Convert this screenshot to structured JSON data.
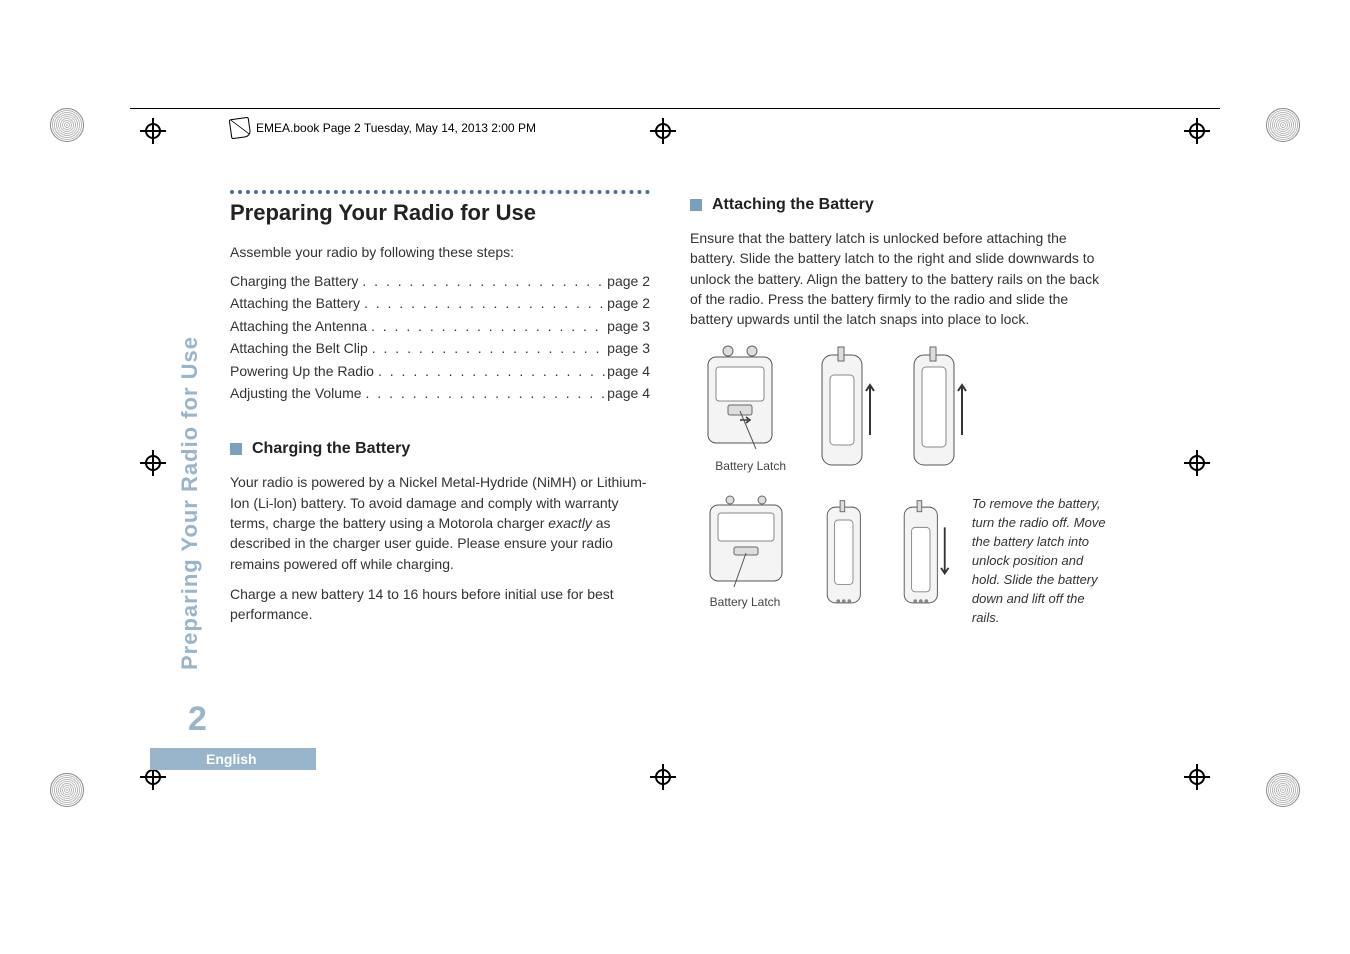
{
  "header": {
    "stamp": "EMEA.book  Page 2  Tuesday, May 14, 2013  2:00 PM"
  },
  "sideTab": "Preparing Your Radio for Use",
  "pageNumber": "2",
  "language": "English",
  "left": {
    "title": "Preparing Your Radio for Use",
    "intro": "Assemble your radio by following these steps:",
    "toc": [
      {
        "label": "Charging the Battery",
        "page": "page 2"
      },
      {
        "label": "Attaching the Battery",
        "page": "page 2"
      },
      {
        "label": "Attaching the Antenna",
        "page": "page 3"
      },
      {
        "label": "Attaching the Belt Clip",
        "page": "page 3"
      },
      {
        "label": "Powering Up the Radio",
        "page": "page 4"
      },
      {
        "label": "Adjusting the Volume",
        "page": "page 4"
      }
    ],
    "section1": {
      "heading": "Charging the Battery",
      "p1a": "Your radio is powered by a Nickel Metal-Hydride (NiMH) or Lithium-Ion (Li-lon) battery. To avoid damage and comply with warranty terms, charge the battery using a Motorola charger ",
      "p1_em": "exactly",
      "p1b": " as described in the charger user guide. Please ensure your radio remains powered off while charging.",
      "p2": "Charge a new battery 14 to 16 hours before initial use for best performance."
    }
  },
  "right": {
    "section2": {
      "heading": "Attaching the Battery",
      "p1": "Ensure that the battery latch is unlocked before attaching the battery. Slide the battery latch to the right and slide downwards to unlock the battery. Align the battery to the battery rails on the back of the radio. Press the battery firmly to the radio and slide the battery upwards until the latch snaps into place to lock.",
      "caption": "Battery Latch",
      "removeNote": "To remove the battery, turn the radio off. Move the battery latch into unlock position and hold. Slide the battery down and lift off the rails."
    }
  }
}
